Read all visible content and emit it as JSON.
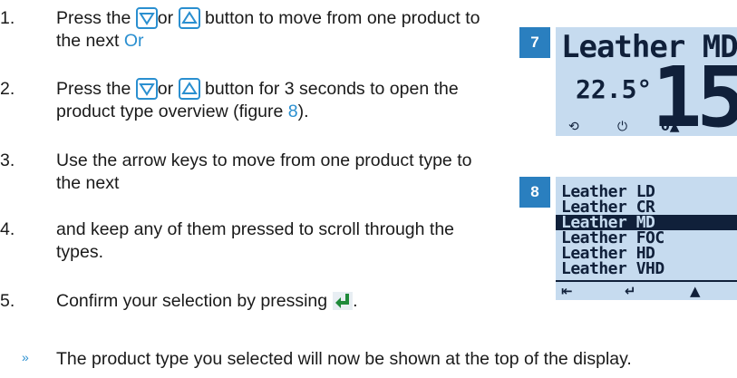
{
  "steps": [
    {
      "num": "1.",
      "pre": "Press the",
      "mid": "or",
      "post": "button to move from one product to the next",
      "tail": "Or"
    },
    {
      "num": "2.",
      "pre": "Press the",
      "mid": "or",
      "post": "button for 3 seconds to open the product type overview (figure",
      "ref": "8",
      "tail": ")."
    },
    {
      "num": "3.",
      "text": "Use the arrow keys to move from one product type to the next"
    },
    {
      "num": "4.",
      "text": "and keep any of them pressed to scroll through the types."
    },
    {
      "num": "5.",
      "text": "Confirm your selection by pressing"
    }
  ],
  "result": {
    "bullet": "»",
    "text": "The product type you selected will now be shown at the top of the display."
  },
  "figure7": {
    "label": "7",
    "title": "Leather MD",
    "temperature": "22.5°",
    "reading": "15.",
    "icons": [
      "refresh-icon",
      "power-icon",
      "zero-icon",
      "up-arrow-icon"
    ],
    "icon_text_zero": "0"
  },
  "figure8": {
    "label": "8",
    "items": [
      "Leather LD",
      "Leather CR",
      "Leather MD",
      "Leather FOC",
      "Leather HD",
      "Leather VHD"
    ],
    "selected_index": 2,
    "icons": [
      "exit-icon",
      "enter-icon",
      "up-arrow-icon"
    ]
  },
  "colors": {
    "accent": "#2a8fd0",
    "tab": "#2a7fbf",
    "lcd_bg": "#c6dbef",
    "lcd_fg": "#10203a"
  }
}
